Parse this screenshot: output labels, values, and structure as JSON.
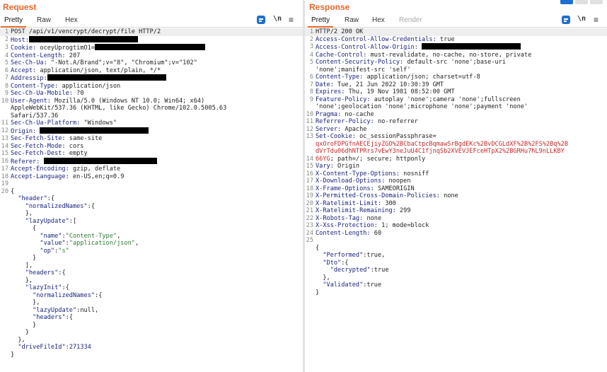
{
  "request": {
    "title": "Request",
    "tabs": [
      {
        "label": "Pretty",
        "active": true
      },
      {
        "label": "Raw",
        "active": false
      },
      {
        "label": "Hex",
        "active": false
      }
    ],
    "tools": {
      "newline": "\\n",
      "menu": "≡"
    },
    "line_numbers": [
      "1",
      "2",
      "3",
      "4",
      "5",
      "6",
      "7",
      "8",
      "9",
      "10",
      "",
      "",
      "11",
      "12",
      "13",
      "14",
      "15",
      "16",
      "17",
      "18",
      "19",
      "20",
      "",
      "",
      "",
      "",
      "",
      "",
      "",
      "",
      "",
      "",
      "",
      "",
      "",
      "",
      "",
      "",
      "",
      "",
      "",
      "",
      "",
      "",
      "",
      ""
    ],
    "lines": [
      {
        "t": "plain",
        "text": "POST /api/v1/vencrypt/decrypt/file HTTP/2",
        "sel": true
      },
      {
        "t": "hdr",
        "k": "Host:",
        "v": "",
        "red": 154
      },
      {
        "t": "hdr",
        "k": "Cookie:",
        "v": " oceyUprogtimO1=",
        "red": 156
      },
      {
        "t": "hdr",
        "k": "Content-Length:",
        "v": " 207"
      },
      {
        "t": "hdr",
        "k": "Sec-Ch-Ua:",
        "v": " \"-Not.A/Brand\";v=\"8\", \"Chromium\";v=\"102\""
      },
      {
        "t": "hdr",
        "k": "Accept:",
        "v": " application/json, text/plain, */*"
      },
      {
        "t": "hdr",
        "k": "Addressip:",
        "v": "",
        "red": 168
      },
      {
        "t": "hdr",
        "k": "Content-Type:",
        "v": " application/json"
      },
      {
        "t": "hdr",
        "k": "Sec-Ch-Ua-Mobile:",
        "v": " ?0"
      },
      {
        "t": "hdr",
        "k": "User-Agent:",
        "v": " Mozilla/5.0 (Windows NT 10.0; Win64; x64)"
      },
      {
        "t": "plain",
        "text": "AppleWebKit/537.36 (KHTML, like Gecko) Chrome/102.0.5005.63"
      },
      {
        "t": "plain",
        "text": "Safari/537.36"
      },
      {
        "t": "hdr",
        "k": "Sec-Ch-Ua-Platform:",
        "v": " \"Windows\""
      },
      {
        "t": "hdr",
        "k": "Origin:",
        "v": " ",
        "red": 154
      },
      {
        "t": "hdr",
        "k": "Sec-Fetch-Site:",
        "v": " same-site"
      },
      {
        "t": "hdr",
        "k": "Sec-Fetch-Mode:",
        "v": " cors"
      },
      {
        "t": "hdr",
        "k": "Sec-Fetch-Dest:",
        "v": " empty"
      },
      {
        "t": "hdr",
        "k": "Referer:",
        "v": " ",
        "red": 160
      },
      {
        "t": "hdr",
        "k": "Accept-Encoding:",
        "v": " gzip, deflate"
      },
      {
        "t": "hdr",
        "k": "Accept-Language:",
        "v": " en-US,en;q=0.9"
      },
      {
        "t": "plain",
        "text": ""
      },
      {
        "t": "plain",
        "text": "{"
      },
      {
        "t": "json",
        "ind": 1,
        "key": "\"header\"",
        "rest": ":{"
      },
      {
        "t": "json",
        "ind": 2,
        "key": "\"normalizedNames\"",
        "rest": ":{"
      },
      {
        "t": "json",
        "ind": 2,
        "rest": "},"
      },
      {
        "t": "json",
        "ind": 2,
        "key": "\"lazyUpdate\"",
        "rest": ":["
      },
      {
        "t": "json",
        "ind": 3,
        "rest": "{"
      },
      {
        "t": "json",
        "ind": 4,
        "key": "\"name\"",
        "rest": ":",
        "sval": "\"Content-Type\"",
        "tail": ","
      },
      {
        "t": "json",
        "ind": 4,
        "key": "\"value\"",
        "rest": ":",
        "sval": "\"application/json\"",
        "tail": ","
      },
      {
        "t": "json",
        "ind": 4,
        "key": "\"op\"",
        "rest": ":",
        "sval": "\"s\"",
        "tail": ""
      },
      {
        "t": "json",
        "ind": 3,
        "rest": "}"
      },
      {
        "t": "json",
        "ind": 2,
        "rest": "],"
      },
      {
        "t": "json",
        "ind": 2,
        "key": "\"headers\"",
        "rest": ":{"
      },
      {
        "t": "json",
        "ind": 2,
        "rest": "},"
      },
      {
        "t": "json",
        "ind": 2,
        "key": "\"lazyInit\"",
        "rest": ":{"
      },
      {
        "t": "json",
        "ind": 3,
        "key": "\"normalizedNames\"",
        "rest": ":{"
      },
      {
        "t": "json",
        "ind": 3,
        "rest": "},"
      },
      {
        "t": "json",
        "ind": 3,
        "key": "\"lazyUpdate\"",
        "rest": ":null,"
      },
      {
        "t": "json",
        "ind": 3,
        "key": "\"headers\"",
        "rest": ":{"
      },
      {
        "t": "json",
        "ind": 3,
        "rest": "}"
      },
      {
        "t": "json",
        "ind": 2,
        "rest": "}"
      },
      {
        "t": "json",
        "ind": 1,
        "rest": "},"
      },
      {
        "t": "json",
        "ind": 1,
        "key": "\"driveFileId\"",
        "rest": ":",
        "nval": "271334"
      },
      {
        "t": "plain",
        "text": "}"
      }
    ]
  },
  "response": {
    "title": "Response",
    "tabs": [
      {
        "label": "Pretty",
        "active": true
      },
      {
        "label": "Raw",
        "active": false
      },
      {
        "label": "Hex",
        "active": false
      },
      {
        "label": "Render",
        "active": false,
        "disabled": true
      }
    ],
    "tools": {
      "newline": "\\n",
      "menu": "≡"
    },
    "line_numbers": [
      "1",
      "2",
      "3",
      "4",
      "5",
      "",
      "6",
      "7",
      "8",
      "9",
      "",
      "10",
      "11",
      "12",
      "13",
      "",
      "",
      "14",
      "15",
      "16",
      "17",
      "18",
      "19",
      "20",
      "21",
      "22",
      "23",
      "24",
      "25",
      "",
      "",
      "",
      "",
      "",
      ""
    ],
    "lines": [
      {
        "t": "plain",
        "text": "HTTP/2 200 OK",
        "sel": true
      },
      {
        "t": "hdr",
        "k": "Access-Control-Allow-Credentials:",
        "v": " true"
      },
      {
        "t": "hdr",
        "k": "Access-Control-Allow-Origin:",
        "v": " ",
        "red": 140
      },
      {
        "t": "hdr",
        "k": "Cache-Control:",
        "v": " must-revalidate, no-cache, no-store, private"
      },
      {
        "t": "hdr",
        "k": "Content-Security-Policy:",
        "v": " default-src 'none';base-uri"
      },
      {
        "t": "plain",
        "text": "'none';manifest-src 'self'"
      },
      {
        "t": "hdr",
        "k": "Content-Type:",
        "v": " application/json; charset=utf-8"
      },
      {
        "t": "hdr",
        "k": "Date:",
        "v": " Tue, 21 Jun 2022 10:30:39 GMT"
      },
      {
        "t": "hdr",
        "k": "Expires:",
        "v": " Thu, 19 Nov 1981 08:52:00 GMT"
      },
      {
        "t": "hdr",
        "k": "Feature-Policy:",
        "v": " autoplay 'none';camera 'none';fullscreen"
      },
      {
        "t": "plain",
        "text": "'none';geolocation 'none';microphone 'none';payment 'none'"
      },
      {
        "t": "hdr",
        "k": "Pragma:",
        "v": " no-cache"
      },
      {
        "t": "hdr",
        "k": "Referrer-Policy:",
        "v": " no-referrer"
      },
      {
        "t": "hdr",
        "k": "Server:",
        "v": " Apache"
      },
      {
        "t": "hdr",
        "k": "Set-Cookie:",
        "v": " oc_sessionPassphrase="
      },
      {
        "t": "cookie",
        "text": "qxOroFDPGfnAECEjiyZGO%2BCbaCtpcBqmawSrBgdEKc%2BvDCGLdXF%2B%2FS%2Bq%2B"
      },
      {
        "t": "cookie",
        "text": "dVrTdu06dhNTPRrs7vEwY3neJuU4C1fjnqSb2XVEVJEFceHTpX2%2BGRHu7hL9nLLKBY",
        "post": ""
      },
      {
        "t": "cookietail",
        "text": "66YG",
        "tail": "; path=/; secure; httponly"
      },
      {
        "t": "hdr",
        "k": "Vary:",
        "v": " Origin"
      },
      {
        "t": "hdr",
        "k": "X-Content-Type-Options:",
        "v": " nosniff"
      },
      {
        "t": "hdr",
        "k": "X-Download-Options:",
        "v": " noopen"
      },
      {
        "t": "hdr",
        "k": "X-Frame-Options:",
        "v": " SAMEORIGIN"
      },
      {
        "t": "hdr",
        "k": "X-Permitted-Cross-Domain-Policies:",
        "v": " none"
      },
      {
        "t": "hdr",
        "k": "X-Ratelimit-Limit:",
        "v": " 300"
      },
      {
        "t": "hdr",
        "k": "X-Ratelimit-Remaining:",
        "v": " 299"
      },
      {
        "t": "hdr",
        "k": "X-Robots-Tag:",
        "v": " none"
      },
      {
        "t": "hdr",
        "k": "X-Xss-Protection:",
        "v": " 1; mode=block"
      },
      {
        "t": "hdr",
        "k": "Content-Length:",
        "v": " 60"
      },
      {
        "t": "plain",
        "text": ""
      },
      {
        "t": "plain",
        "text": "{"
      },
      {
        "t": "json",
        "ind": 1,
        "key": "\"Performed\"",
        "rest": ":true,"
      },
      {
        "t": "json",
        "ind": 1,
        "key": "\"Dto\"",
        "rest": ":{"
      },
      {
        "t": "json",
        "ind": 2,
        "key": "\"decrypted\"",
        "rest": ":true"
      },
      {
        "t": "json",
        "ind": 1,
        "rest": "},"
      },
      {
        "t": "json",
        "ind": 1,
        "key": "\"Validated\"",
        "rest": ":true"
      },
      {
        "t": "plain",
        "text": "}"
      }
    ]
  }
}
